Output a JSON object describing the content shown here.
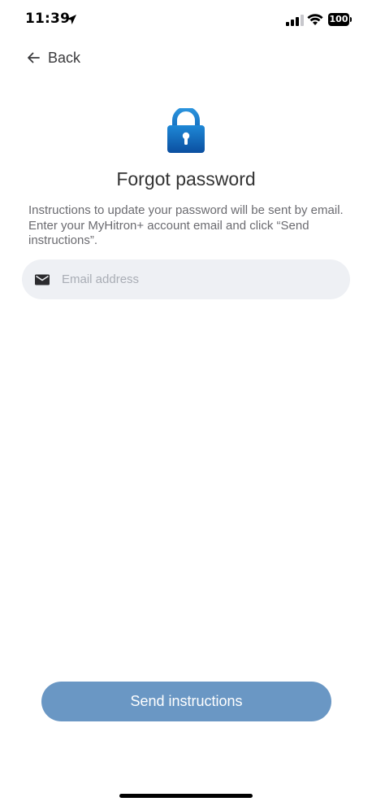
{
  "status_bar": {
    "time": "11:39",
    "battery_level": "100",
    "icons": [
      "location-arrow-icon",
      "cellular-signal-icon",
      "wifi-icon",
      "battery-icon"
    ]
  },
  "nav": {
    "back_label": "Back",
    "back_icon": "arrow-left-icon"
  },
  "header": {
    "icon": "lock-icon",
    "title": "Forgot password"
  },
  "instructions": "Instructions to update your password will be sent by email. Enter your MyHitron+ account email and click “Send instructions”.",
  "email_field": {
    "icon": "mail-icon",
    "placeholder": "Email address",
    "value": ""
  },
  "actions": {
    "send_label": "Send instructions"
  },
  "colors": {
    "primary_button": "#6a97c4",
    "field_background": "#eef0f4",
    "lock_gradient_top": "#1e88d6",
    "lock_gradient_bottom": "#0b4fa0"
  }
}
